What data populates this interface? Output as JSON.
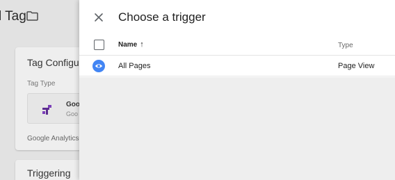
{
  "background_editor": {
    "tag_title": "l Tag",
    "folder_icon": "folder-icon",
    "tag_configuration": {
      "title": "Tag Configura",
      "tag_type_label": "Tag Type",
      "tag_type_name": "Goo",
      "tag_type_sub": "Goo",
      "tag_type_icon": "google-analytics-icon",
      "footer": "Google Analytics"
    },
    "triggering": {
      "title": "Triggering"
    }
  },
  "trigger_panel": {
    "close_icon": "close-icon",
    "title": "Choose a trigger",
    "columns": {
      "name": "Name",
      "sort_indicator": "↑",
      "type": "Type"
    },
    "rows": [
      {
        "icon": "eye-icon",
        "name": "All Pages",
        "type": "Page View",
        "icon_color": "#4285f4"
      }
    ]
  },
  "colors": {
    "accent": "#4285f4",
    "ga_purple": "#7b3fb8",
    "ga_purple_dark": "#5b2c8f"
  }
}
